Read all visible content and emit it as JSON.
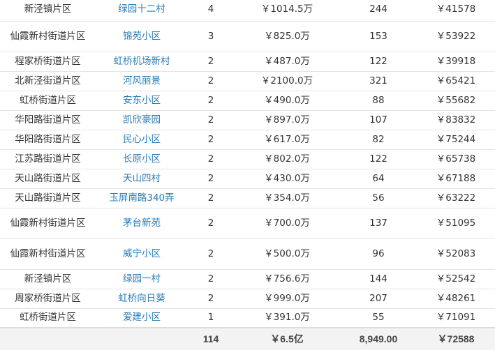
{
  "colors": {
    "link": "#2a7db8",
    "text": "#333333",
    "border": "#e5e5e5",
    "total_bg": "#f3f3f3"
  },
  "rows": [
    {
      "area": "新泾镇片区",
      "name": "绿园十二村",
      "count": "4",
      "price": "￥1014.5万",
      "area_sqm": "244",
      "unit_price": "￥41578"
    },
    {
      "area": "仙霞新村街道片区",
      "name": "锦苑小区",
      "count": "3",
      "price": "￥825.0万",
      "area_sqm": "153",
      "unit_price": "￥53922"
    },
    {
      "area": "程家桥街道片区",
      "name": "虹桥机场新村",
      "count": "2",
      "price": "￥487.0万",
      "area_sqm": "122",
      "unit_price": "￥39918"
    },
    {
      "area": "北新泾街道片区",
      "name": "河风丽景",
      "count": "2",
      "price": "￥2100.0万",
      "area_sqm": "321",
      "unit_price": "￥65421"
    },
    {
      "area": "虹桥街道片区",
      "name": "安东小区",
      "count": "2",
      "price": "￥490.0万",
      "area_sqm": "88",
      "unit_price": "￥55682"
    },
    {
      "area": "华阳路街道片区",
      "name": "凯欣豪园",
      "count": "2",
      "price": "￥897.0万",
      "area_sqm": "107",
      "unit_price": "￥83832"
    },
    {
      "area": "华阳路街道片区",
      "name": "民心小区",
      "count": "2",
      "price": "￥617.0万",
      "area_sqm": "82",
      "unit_price": "￥75244"
    },
    {
      "area": "江苏路街道片区",
      "name": "长原小区",
      "count": "2",
      "price": "￥802.0万",
      "area_sqm": "122",
      "unit_price": "￥65738"
    },
    {
      "area": "天山路街道片区",
      "name": "天山四村",
      "count": "2",
      "price": "￥430.0万",
      "area_sqm": "64",
      "unit_price": "￥67188"
    },
    {
      "area": "天山路街道片区",
      "name": "玉屏南路340弄",
      "count": "2",
      "price": "￥354.0万",
      "area_sqm": "56",
      "unit_price": "￥63222"
    },
    {
      "area": "仙霞新村街道片区",
      "name": "茅台新苑",
      "count": "2",
      "price": "￥700.0万",
      "area_sqm": "137",
      "unit_price": "￥51095"
    },
    {
      "area": "仙霞新村街道片区",
      "name": "威宁小区",
      "count": "2",
      "price": "￥500.0万",
      "area_sqm": "96",
      "unit_price": "￥52083"
    },
    {
      "area": "新泾镇片区",
      "name": "绿园一村",
      "count": "2",
      "price": "￥756.6万",
      "area_sqm": "144",
      "unit_price": "￥52542"
    },
    {
      "area": "周家桥街道片区",
      "name": "虹桥向日葵",
      "count": "2",
      "price": "￥999.0万",
      "area_sqm": "207",
      "unit_price": "￥48261"
    },
    {
      "area": "虹桥街道片区",
      "name": "爱建小区",
      "count": "1",
      "price": "￥391.0万",
      "area_sqm": "55",
      "unit_price": "￥71091"
    }
  ],
  "total": {
    "count": "114",
    "price": "￥6.5亿",
    "area_sqm": "8,949.00",
    "unit_price": "￥72588"
  }
}
